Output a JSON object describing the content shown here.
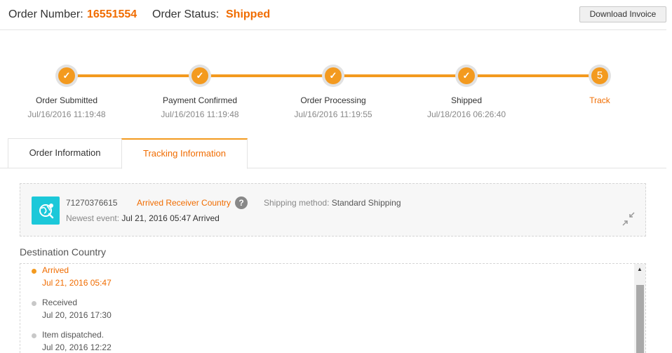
{
  "header": {
    "order_number_label": "Order Number:",
    "order_number": "16551554",
    "order_status_label": "Order Status:",
    "order_status": "Shipped",
    "download_invoice": "Download Invoice"
  },
  "progress": {
    "steps": [
      {
        "label": "Order Submitted",
        "time": "Jul/16/2016 11:19:48",
        "icon": "check-icon"
      },
      {
        "label": "Payment Confirmed",
        "time": "Jul/16/2016 11:19:48",
        "icon": "check-icon"
      },
      {
        "label": "Order Processing",
        "time": "Jul/16/2016 11:19:55",
        "icon": "check-icon"
      },
      {
        "label": "Shipped",
        "time": "Jul/18/2016 06:26:40",
        "icon": "check-icon"
      },
      {
        "label": "Track",
        "number": "5"
      }
    ],
    "accent": "#f39a1f"
  },
  "tabs": [
    {
      "label": "Order Information",
      "active": false
    },
    {
      "label": "Tracking Information",
      "active": true
    }
  ],
  "tracking": {
    "number": "71270376615",
    "status": "Arrived Receiver Country",
    "help": "?",
    "shipping_method_label": "Shipping method:",
    "shipping_method": "Standard Shipping",
    "newest_event_label": "Newest event:",
    "newest_event": "Jul 21, 2016 05:47 Arrived",
    "icon": "package-globe-icon",
    "collapse_icon": "collapse-arrows-icon"
  },
  "destination": {
    "title": "Destination Country",
    "events": [
      {
        "desc": "Arrived",
        "time": "Jul 21, 2016 05:47",
        "active": true
      },
      {
        "desc": "Received",
        "time": "Jul 20, 2016 17:30",
        "active": false
      },
      {
        "desc": "Item dispatched.",
        "time": "Jul 20, 2016 12:22",
        "active": false
      }
    ]
  },
  "colors": {
    "brand_orange": "#f06c00",
    "progress_orange": "#f39a1f",
    "icon_teal": "#1cc8d9"
  }
}
